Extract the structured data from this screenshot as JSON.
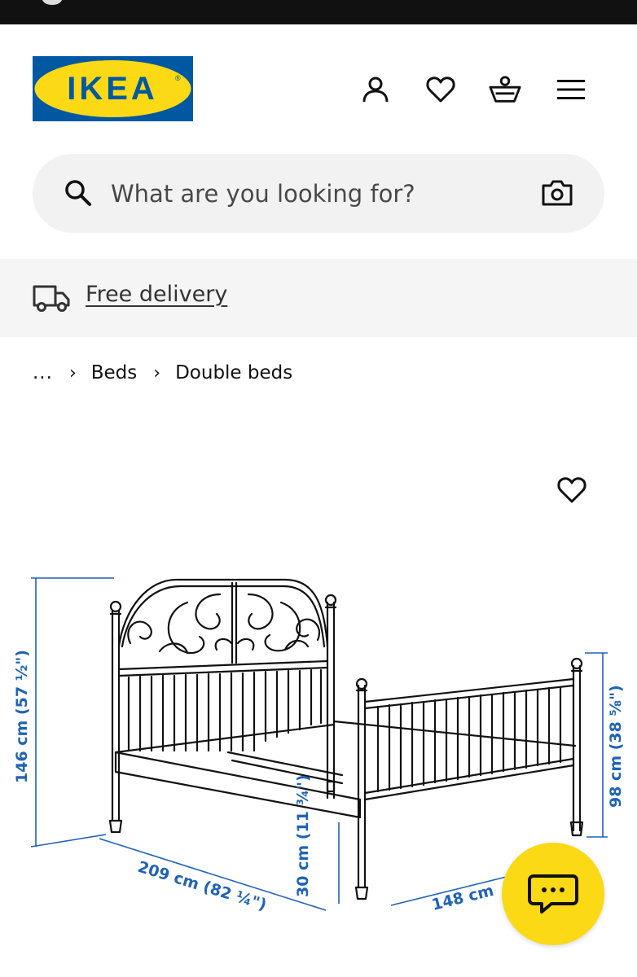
{
  "brand": {
    "logo_text": "IKEA"
  },
  "header_icons": [
    "profile-icon",
    "heart-icon",
    "basket-icon",
    "menu-icon"
  ],
  "search": {
    "placeholder": "What are you looking for?"
  },
  "delivery": {
    "label": "Free delivery"
  },
  "breadcrumb": {
    "ellipsis": "...",
    "items": [
      "Beds",
      "Double beds"
    ]
  },
  "product": {
    "dimensions": {
      "total_height": "146 cm (57 ½\")",
      "frame_height": "30 cm (11 ¾\")",
      "footboard_height": "98 cm (38 ⅝\")",
      "length": "209 cm (82 ¼\")",
      "width": "148 cm"
    }
  },
  "colors": {
    "brand_blue": "#0058a3",
    "brand_yellow": "#fbd914",
    "dimension_blue": "#1f63b8"
  }
}
